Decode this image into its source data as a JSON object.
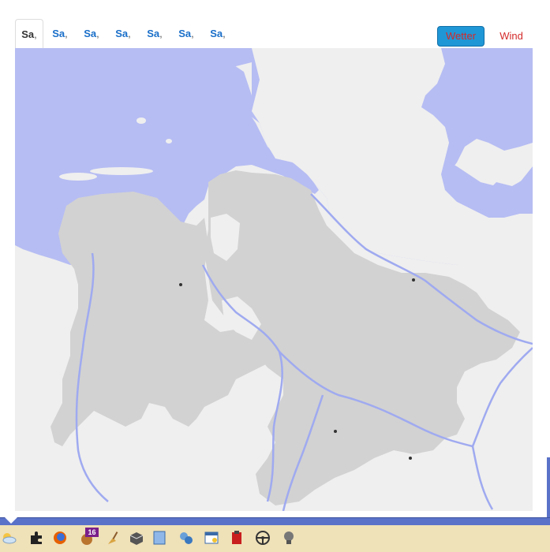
{
  "tabs": [
    {
      "label": "Sa",
      "sep": ","
    },
    {
      "label": "Sa",
      "sep": ","
    },
    {
      "label": "Sa",
      "sep": ","
    },
    {
      "label": "Sa",
      "sep": ","
    },
    {
      "label": "Sa",
      "sep": ","
    },
    {
      "label": "Sa",
      "sep": ","
    },
    {
      "label": "Sa",
      "sep": ","
    }
  ],
  "buttons": {
    "wetter": "Wetter",
    "wind": "Wind"
  },
  "taskbar": {
    "badge": "16"
  },
  "colors": {
    "water": "#b6bdf3",
    "land_region": "#d2d2d2",
    "land_other": "#efefef",
    "river": "#9faaf0",
    "accent_button": "#1f97d6",
    "button_text": "#d42a2a",
    "tab_link": "#1a6fc9"
  },
  "icons": [
    "weather-cloud-icon",
    "puzzle-icon",
    "firefox-icon",
    "badge-app-icon",
    "broom-icon",
    "package-icon",
    "map-icon",
    "document-icon",
    "network-icon",
    "window-icon",
    "clipboard-icon",
    "steering-icon",
    "bulb-icon"
  ]
}
